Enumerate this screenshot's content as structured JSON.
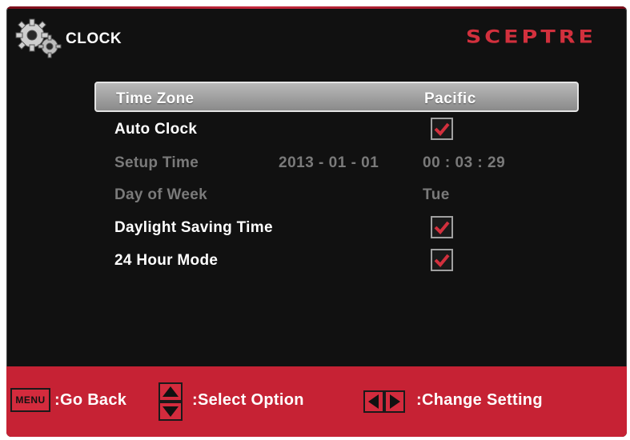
{
  "header": {
    "title": "CLOCK",
    "brand": "SCEPTRE"
  },
  "menu": {
    "rows": [
      {
        "label": "Time Zone",
        "value": "Pacific",
        "state": "selected"
      },
      {
        "label": "Auto Clock",
        "checked": true,
        "state": "enabled"
      },
      {
        "label": "Setup Time",
        "date": "2013 - 01 - 01",
        "value": "00 : 03 : 29",
        "state": "disabled"
      },
      {
        "label": "Day of Week",
        "value": "Tue",
        "state": "disabled"
      },
      {
        "label": "Daylight Saving Time",
        "checked": true,
        "state": "enabled"
      },
      {
        "label": "24 Hour Mode",
        "checked": true,
        "state": "enabled"
      }
    ]
  },
  "footer": {
    "menu_key": "MENU",
    "go_back": ":Go Back",
    "select_option": ":Select Option",
    "change_setting": ":Change Setting"
  },
  "colors": {
    "accent_red": "#c62234",
    "checkmark": "#d2303d",
    "background": "#111111",
    "disabled_text": "#7a7a7a"
  },
  "icons": [
    "gear-icon",
    "checkmark-icon",
    "menu-key-icon",
    "up-down-arrows-icon",
    "left-right-arrows-icon"
  ]
}
